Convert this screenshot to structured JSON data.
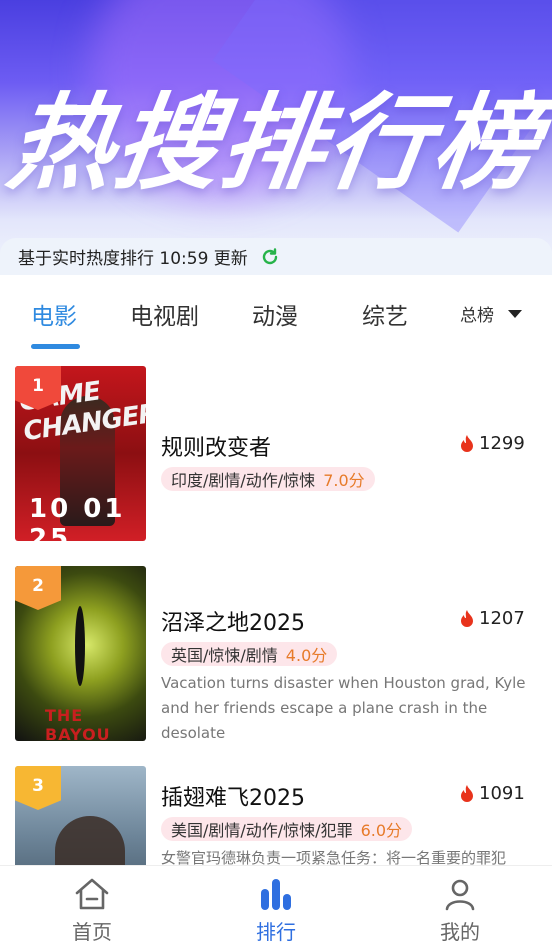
{
  "header": {
    "banner_title": "热搜排行榜",
    "update_text": "基于实时热度排行 10:59 更新"
  },
  "tabs": [
    {
      "label": "电影",
      "active": true
    },
    {
      "label": "电视剧",
      "active": false
    },
    {
      "label": "动漫",
      "active": false
    },
    {
      "label": "综艺",
      "active": false
    }
  ],
  "rank_filter": {
    "label": "总榜"
  },
  "colors": {
    "accent": "#2f8ae0",
    "heat": "#e8331c",
    "score": "#e77b2a",
    "tag_bg": "#fde6ea",
    "rank1": "#f0493b",
    "rank2": "#f5993a",
    "rank3": "#f7b733"
  },
  "items": [
    {
      "rank": "1",
      "title": "规则改变者",
      "heat": "1299",
      "tags": "印度/剧情/动作/惊悚",
      "score": "7.0分",
      "description": "",
      "poster_text": "GAME CHANGER",
      "poster_date": "10 01 25"
    },
    {
      "rank": "2",
      "title": "沼泽之地2025",
      "heat": "1207",
      "tags": "英国/惊悚/剧情",
      "score": "4.0分",
      "description": "Vacation turns disaster when Houston grad, Kyle and her friends escape a plane crash in the desolate",
      "poster_text": "THE BAYOU"
    },
    {
      "rank": "3",
      "title": "插翅难飞2025",
      "heat": "1091",
      "tags": "美国/剧情/动作/惊悚/犯罪",
      "score": "6.0分",
      "description": "女警官玛德琳负责一项紧急任务：将一名重要的罪犯"
    }
  ],
  "bottom_nav": [
    {
      "label": "首页",
      "icon": "home-icon",
      "active": false
    },
    {
      "label": "排行",
      "icon": "ranking-icon",
      "active": true
    },
    {
      "label": "我的",
      "icon": "profile-icon",
      "active": false
    }
  ]
}
